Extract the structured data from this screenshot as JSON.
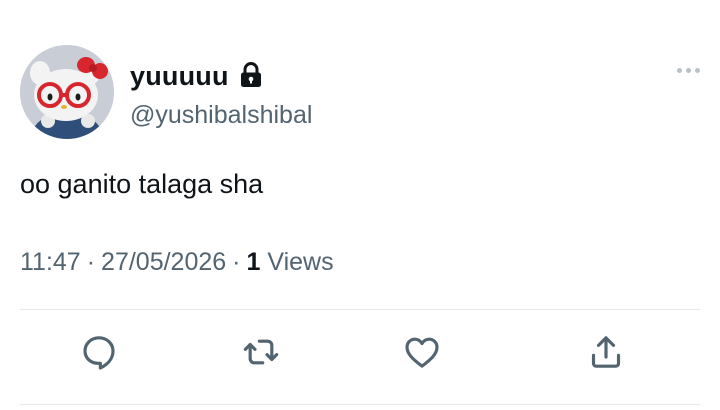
{
  "author": {
    "display_name": "yuuuuu",
    "handle": "@yushibalshibal",
    "protected_icon": "lock-icon",
    "avatar_icon": "hello-kitty-avatar"
  },
  "tweet": {
    "text": "oo ganito talaga sha",
    "time": "11:47",
    "date": "27/05/2026",
    "separator": "·",
    "views_count": "1",
    "views_label": "Views"
  },
  "actions": [
    {
      "name": "reply",
      "icon": "reply-icon"
    },
    {
      "name": "retweet",
      "icon": "retweet-icon"
    },
    {
      "name": "like",
      "icon": "heart-icon"
    },
    {
      "name": "share",
      "icon": "share-icon"
    }
  ],
  "colors": {
    "primary_text": "#0f1419",
    "secondary_text": "#536471",
    "divider": "#e6e9ec",
    "more_dots": "#b9c0c6"
  }
}
